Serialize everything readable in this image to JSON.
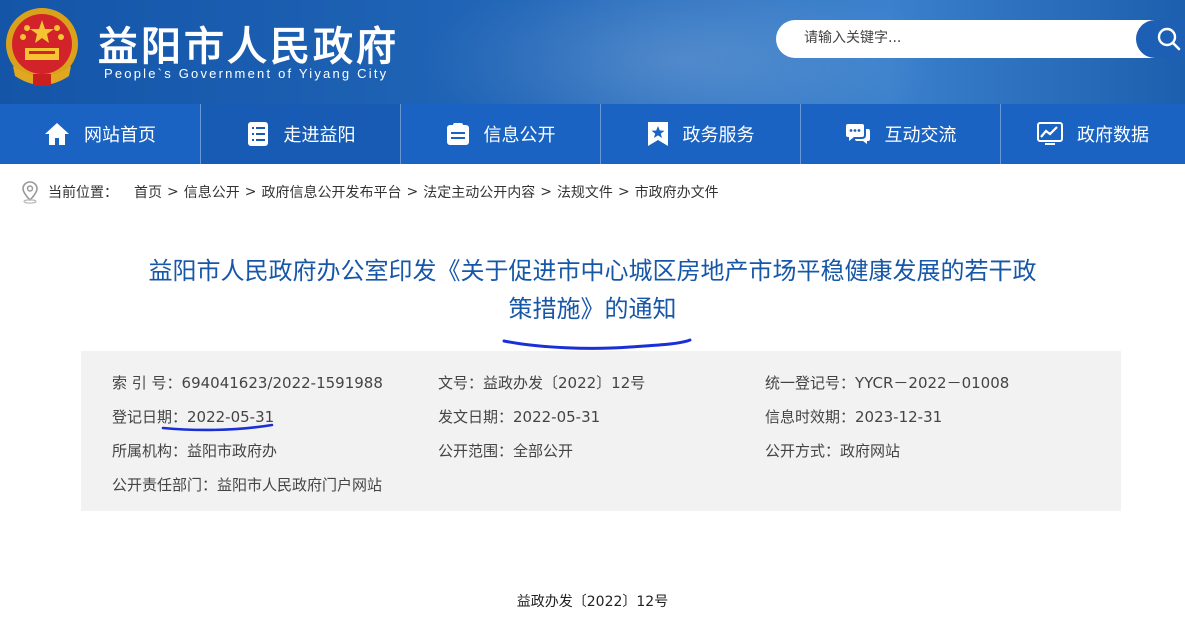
{
  "header": {
    "site_title": "益阳市人民政府",
    "site_subtitle": "People`s Government of Yiyang City",
    "search_placeholder": "请输入关键字..."
  },
  "nav": {
    "items": [
      {
        "label": "网站首页",
        "icon": "home-icon"
      },
      {
        "label": "走进益阳",
        "icon": "document-list-icon"
      },
      {
        "label": "信息公开",
        "icon": "info-card-icon"
      },
      {
        "label": "政务服务",
        "icon": "star-bookmark-icon"
      },
      {
        "label": "互动交流",
        "icon": "chat-bubbles-icon"
      },
      {
        "label": "政府数据",
        "icon": "chart-icon"
      }
    ]
  },
  "breadcrumb": {
    "label": "当前位置：",
    "items": [
      "首页",
      "信息公开",
      "政府信息公开发布平台",
      "法定主动公开内容",
      "法规文件",
      "市政府办文件"
    ],
    "separator": ">"
  },
  "article": {
    "title_line1": "益阳市人民政府办公室印发《关于促进市中心城区房地产市场平稳健康发展的若干政",
    "title_line2": "策措施》的通知",
    "doc_number": "益政办发〔2022〕12号"
  },
  "info": {
    "index_no": "索 引 号：694041623/2022-1591988",
    "wenhao": "文号：益政办发〔2022〕12号",
    "unified_reg": "统一登记号：YYCR－2022－01008",
    "reg_date": "登记日期：2022-05-31",
    "issue_date": "发文日期：2022-05-31",
    "valid_date": "信息时效期：2023-12-31",
    "agency": "所属机构：益阳市政府办",
    "scope": "公开范围：全部公开",
    "method": "公开方式：政府网站",
    "dept": "公开责任部门：益阳市人民政府门户网站"
  },
  "colors": {
    "header_blue": "#1455a8",
    "nav_blue": "#1a63c2",
    "title_blue": "#1757a8",
    "annotation_ink": "#1a2fd6",
    "info_bg": "#f2f2f2"
  }
}
